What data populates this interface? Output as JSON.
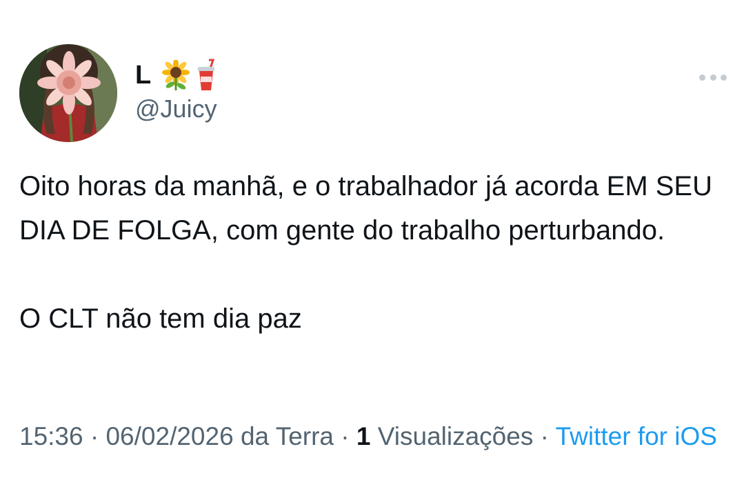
{
  "author": {
    "display_name": "L",
    "emoji_icons": [
      "sunflower-icon",
      "cup-with-straw-icon"
    ],
    "handle": "@Juicy"
  },
  "tweet": {
    "paragraphs": [
      "Oito horas da manhã, e o trabalhador já acorda EM SEU DIA DE FOLGA, com gente do trabalho perturbando.",
      "O CLT não tem dia paz"
    ]
  },
  "meta": {
    "time": "15:36",
    "separator": "·",
    "date": "06/02/2026 da Terra",
    "views_count": "1",
    "views_label": "Visualizações",
    "source": "Twitter for iOS"
  },
  "colors": {
    "text": "#0f1419",
    "secondary": "#536471",
    "link": "#1d9bf0"
  }
}
